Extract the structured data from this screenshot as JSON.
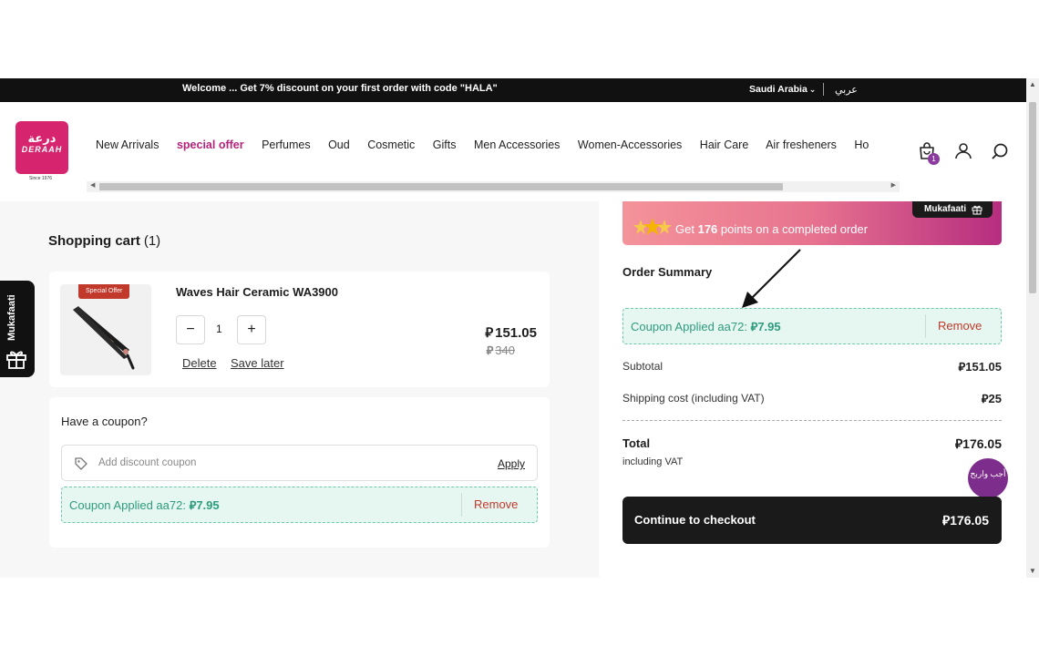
{
  "topbar": {
    "promo": "Welcome ... Get 7% discount on your first order with code \"HALA\"",
    "country": "Saudi Arabia",
    "language": "عربي"
  },
  "logo": {
    "arabic": "درعة",
    "english": "DERAAH",
    "since": "Since 1976"
  },
  "nav": {
    "items": [
      "New Arrivals",
      "special offer",
      "Perfumes",
      "Oud",
      "Cosmetic",
      "Gifts",
      "Men Accessories",
      "Women-Accessories",
      "Hair Care",
      "Air fresheners",
      "Ho"
    ]
  },
  "header": {
    "cart_count": "1"
  },
  "cart": {
    "title": "Shopping cart",
    "count": "(1)",
    "item": {
      "tag": "Special Offer",
      "name": "Waves Hair Ceramic WA3900",
      "quantity": "1",
      "price": "151.05",
      "old_price": "340",
      "delete_label": "Delete",
      "save_label": "Save later"
    }
  },
  "coupon": {
    "question": "Have a coupon?",
    "placeholder": "Add discount coupon",
    "apply_label": "Apply",
    "applied_text": "Coupon Applied aa72:",
    "applied_amount": "7.95",
    "remove_label": "Remove"
  },
  "points": {
    "prefix": "Get",
    "points": "176",
    "suffix": "points on a completed order",
    "tab_label": "Mukafaati"
  },
  "summary": {
    "title": "Order Summary",
    "coupon_text": "Coupon Applied aa72:",
    "coupon_amount": "7.95",
    "remove_label": "Remove",
    "subtotal_label": "Subtotal",
    "subtotal": "151.05",
    "shipping_label": "Shipping cost (including VAT)",
    "shipping": "25",
    "total_label": "Total",
    "total": "176.05",
    "vat_note": "including VAT",
    "checkout_label": "Continue to checkout",
    "checkout_amount": "176.05"
  },
  "game": {
    "label": "أجب واربح"
  },
  "side_tab": {
    "label": "Mukafaati"
  },
  "currency_symbol": "⃁",
  "colors": {
    "accent": "#b3237a",
    "brand": "#d6246e",
    "success": "#2f9c7d",
    "danger": "#c0392b",
    "dark": "#1a1a1a"
  }
}
